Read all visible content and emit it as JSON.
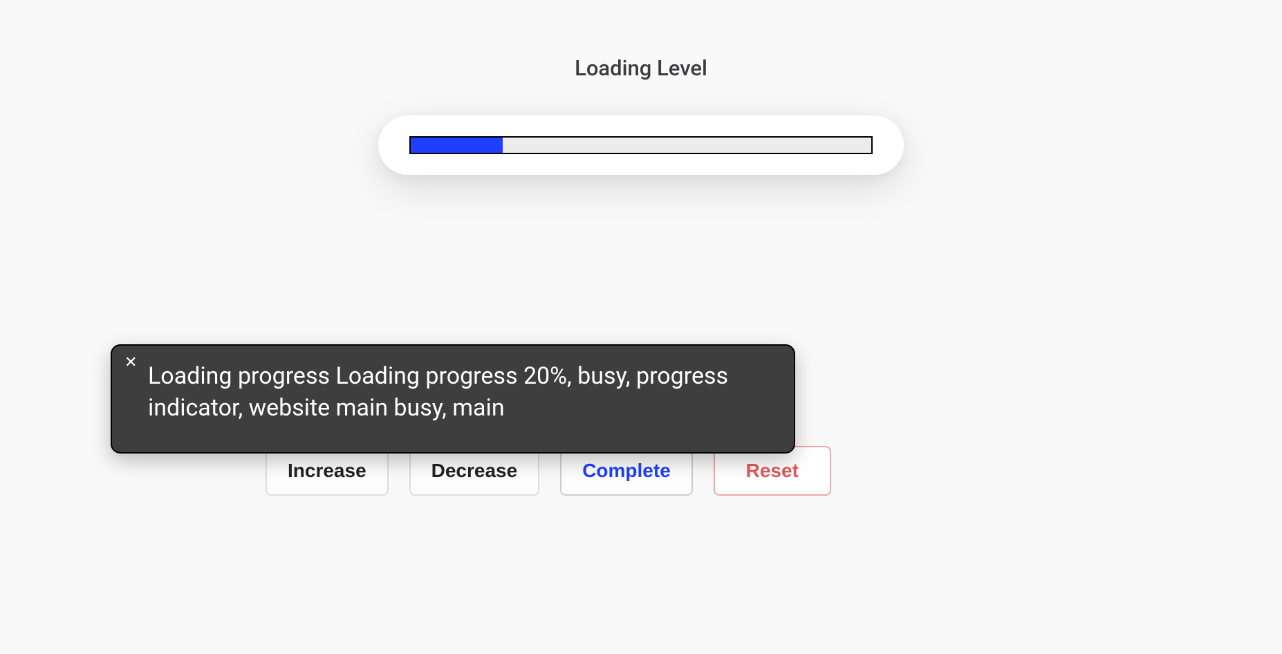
{
  "heading": "Loading Level",
  "progress": {
    "percent": 20
  },
  "buttons": {
    "increase": "Increase",
    "decrease": "Decrease",
    "complete": "Complete",
    "reset": "Reset"
  },
  "tooltip": {
    "text": "Loading progress Loading progress 20%, busy, progress indicator, website main busy, main",
    "close_glyph": "✕"
  }
}
